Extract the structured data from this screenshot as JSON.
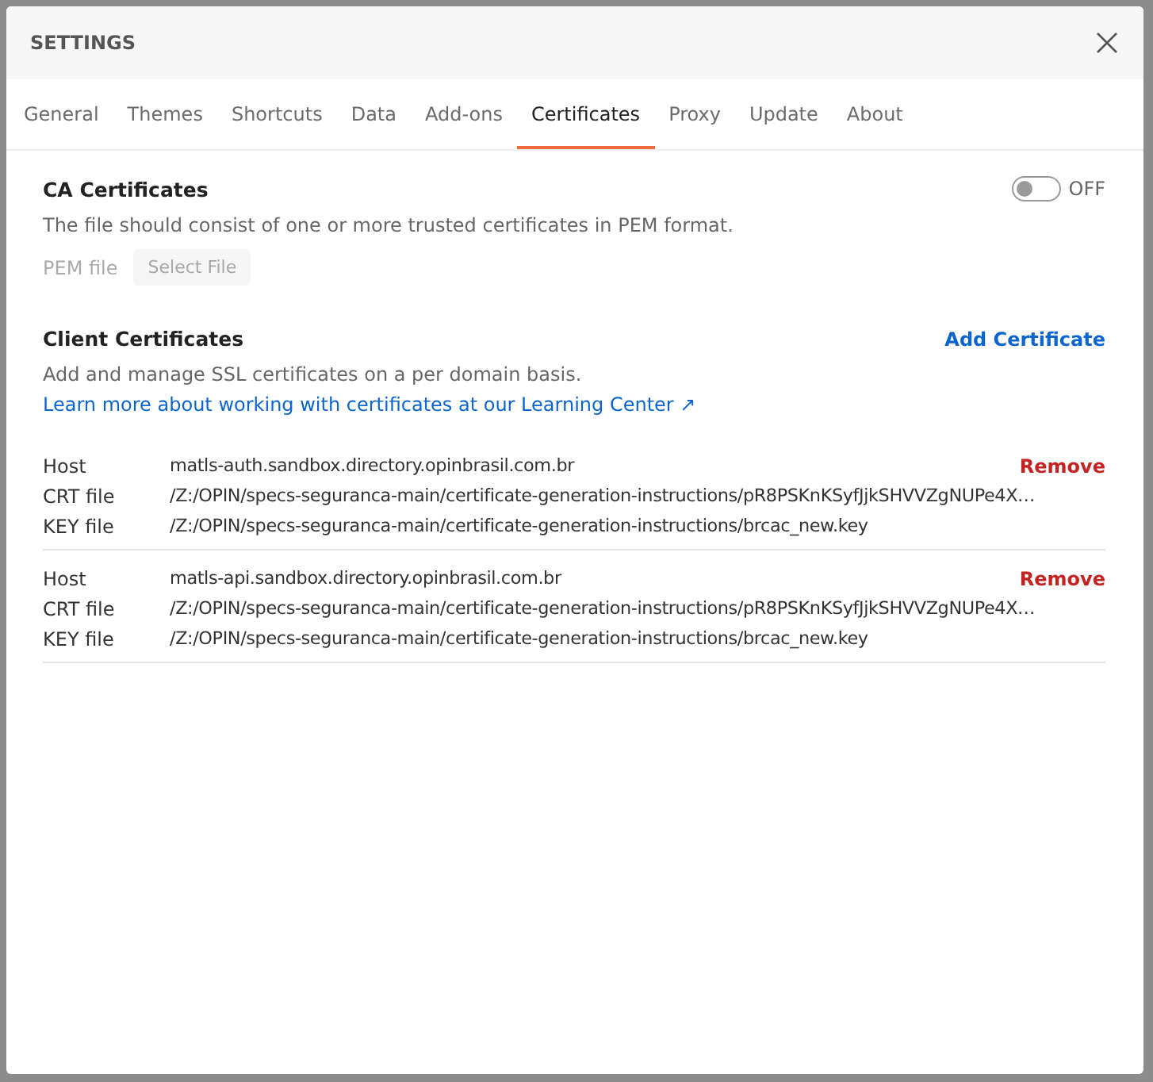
{
  "window": {
    "title": "SETTINGS"
  },
  "tabs": [
    {
      "label": "General",
      "selected": false
    },
    {
      "label": "Themes",
      "selected": false
    },
    {
      "label": "Shortcuts",
      "selected": false
    },
    {
      "label": "Data",
      "selected": false
    },
    {
      "label": "Add-ons",
      "selected": false
    },
    {
      "label": "Certificates",
      "selected": true
    },
    {
      "label": "Proxy",
      "selected": false
    },
    {
      "label": "Update",
      "selected": false
    },
    {
      "label": "About",
      "selected": false
    }
  ],
  "ca_certificates": {
    "title": "CA Certificates",
    "toggle": {
      "on": false,
      "label": "OFF"
    },
    "description": "The file should consist of one or more trusted certificates in PEM format.",
    "pem_label": "PEM file",
    "select_button": {
      "label": "Select File",
      "disabled": true
    }
  },
  "client_certificates": {
    "title": "Client Certificates",
    "add_button": "Add Certificate",
    "description": "Add and manage SSL certificates on a per domain basis.",
    "link": "Learn more about working with certificates at our Learning Center ↗",
    "entries": [
      {
        "remove": "Remove",
        "fields": [
          {
            "label": "Host",
            "value": "matls-auth.sandbox.directory.opinbrasil.com.br"
          },
          {
            "label": "CRT file",
            "value": "/Z:/OPIN/specs-seguranca-main/certificate-generation-instructions/pR8PSKnKSyfJjkSHVVZgNUPe4X…"
          },
          {
            "label": "KEY file",
            "value": "/Z:/OPIN/specs-seguranca-main/certificate-generation-instructions/brcac_new.key"
          }
        ]
      },
      {
        "remove": "Remove",
        "fields": [
          {
            "label": "Host",
            "value": "matls-api.sandbox.directory.opinbrasil.com.br"
          },
          {
            "label": "CRT file",
            "value": "/Z:/OPIN/specs-seguranca-main/certificate-generation-instructions/pR8PSKnKSyfJjkSHVVZgNUPe4X…"
          },
          {
            "label": "KEY file",
            "value": "/Z:/OPIN/specs-seguranca-main/certificate-generation-instructions/brcac_new.key"
          }
        ]
      }
    ]
  }
}
